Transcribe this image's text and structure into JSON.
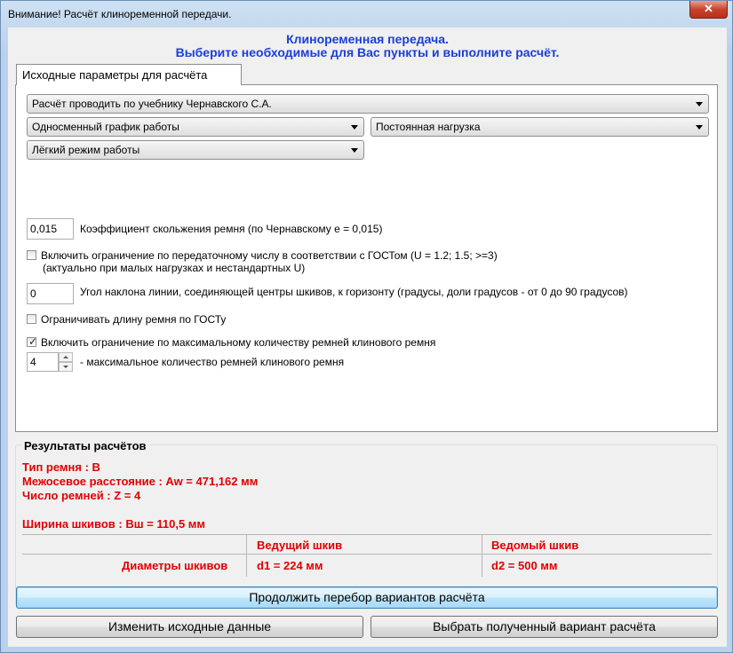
{
  "window": {
    "title": "Внимание! Расчёт клиноременной передачи.",
    "close_label": "✕"
  },
  "header": {
    "line1": "Клиноременная передача.",
    "line2": "Выберите необходимые для Вас пункты и выполните расчёт."
  },
  "tab": {
    "label": "Исходные параметры для расчёта"
  },
  "params": {
    "textbook_select": "Расчёт проводить по учебнику Чернавского С.А.",
    "schedule_select": "Односменный график работы",
    "load_select": "Постоянная нагрузка",
    "mode_select": "Лёгкий режим работы",
    "slip_value": "0,015",
    "slip_label": "Коэффициент скольжения ремня (по Чернавскому e = 0,015)",
    "gost_ratio_label": "Включить ограничение по передаточному числу в соответствии с ГОСТом (U = 1.2; 1.5; >=3)",
    "gost_ratio_note": "(актуально при малых нагрузках и нестандартных U)",
    "gost_ratio_checked": false,
    "angle_value": "0",
    "angle_label": "Угол наклона линии, соединяющей центры шкивов, к горизонту (градусы, доли градусов - от 0 до 90 градусов)",
    "belt_length_label": "Ограничивать длину ремня по ГОСТу",
    "belt_length_checked": false,
    "max_belts_label": "Включить ограничение по максимальному количеству ремней клинового ремня",
    "max_belts_checked": true,
    "max_belts_value": "4",
    "max_belts_desc": "- максимальное количество ремней клинового ремня"
  },
  "results": {
    "title": "Результаты расчётов",
    "belt_type": "Тип ремня :  B",
    "center_distance": "Межосевое расстояние :  Aw = 471,162 мм",
    "belt_count": "Число ремней :  Z = 4",
    "pulley_width": "Ширина шкивов :  Bш = 110,5 мм",
    "table": {
      "col_driving": "Ведущий шкив",
      "col_driven": "Ведомый шкив",
      "row_label": "Диаметры шкивов",
      "d1": "d1 = 224 мм",
      "d2": "d2 = 500 мм"
    }
  },
  "buttons": {
    "continue": "Продолжить перебор вариантов расчёта",
    "change": "Изменить исходные данные",
    "select": "Выбрать полученный вариант расчёта"
  },
  "colors": {
    "header_blue": "#1a3fd6",
    "result_red": "#e00000",
    "window_frame": "#b9d1ea"
  }
}
